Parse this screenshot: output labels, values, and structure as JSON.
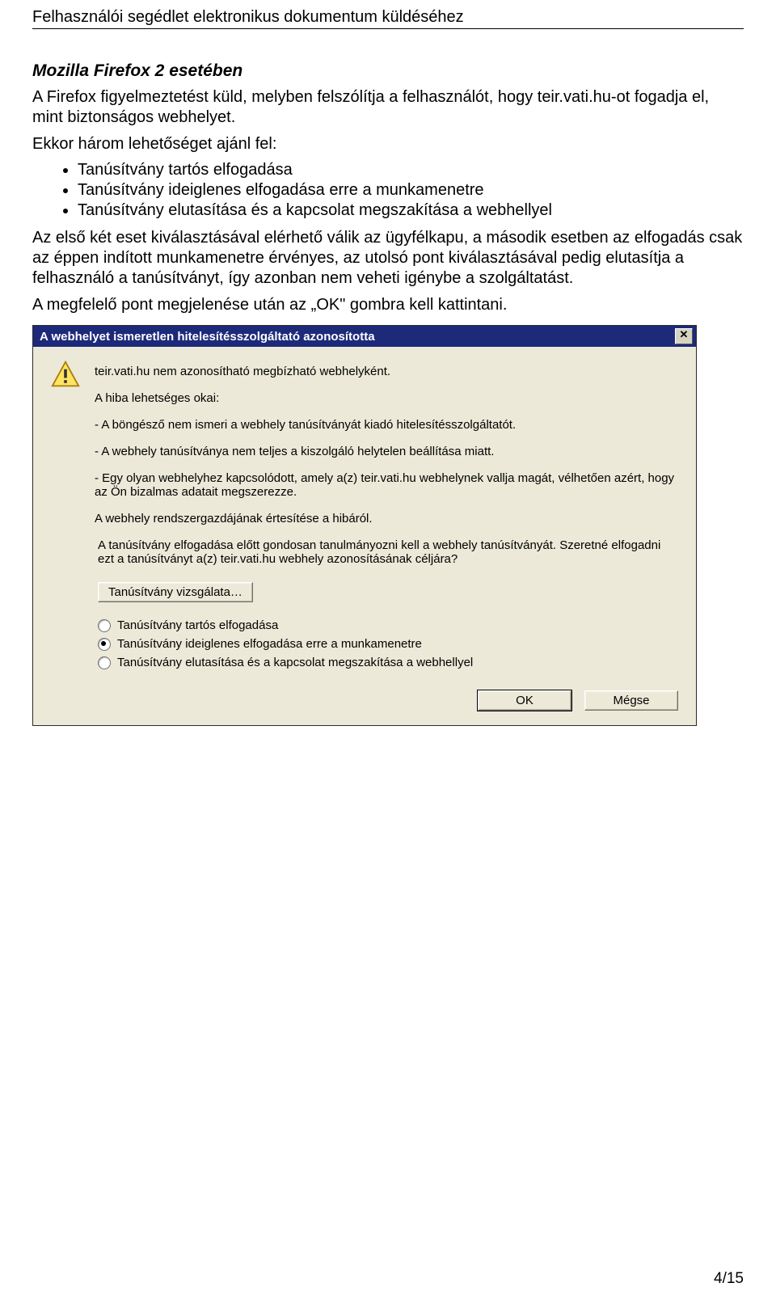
{
  "doc": {
    "header": "Felhasználói segédlet elektronikus dokumentum küldéséhez",
    "section_title": "Mozilla Firefox 2 esetében",
    "intro": "A Firefox figyelmeztetést küld, melyben felszólítja a felhasználót, hogy teir.vati.hu-ot fogadja el, mint biztonságos webhelyet.",
    "list_intro": "Ekkor három lehetőséget ajánl fel:",
    "bullets": [
      "Tanúsítvány tartós elfogadása",
      "Tanúsítvány ideiglenes elfogadása erre a munkamenetre",
      "Tanúsítvány elutasítása és a kapcsolat megszakítása a webhellyel"
    ],
    "para2": "Az első két eset kiválasztásával elérhető válik az ügyfélkapu, a második esetben az elfogadás csak az éppen indított munkamenetre érvényes, az utolsó pont kiválasztásával pedig elutasítja a felhasználó a tanúsítványt, így azonban nem veheti igénybe a szolgáltatást.",
    "para3": "A megfelelő pont megjelenése után az „OK\" gombra kell kattintani.",
    "page_number": "4/15"
  },
  "dialog": {
    "title": "A webhelyet ismeretlen hitelesítésszolgáltató azonosította",
    "line1": "teir.vati.hu nem azonosítható megbízható webhelyként.",
    "reasons_heading": "A hiba lehetséges okai:",
    "reason1": "- A böngésző nem ismeri a webhely tanúsítványát kiadó hitelesítésszolgáltatót.",
    "reason2": "- A webhely tanúsítványa nem teljes a kiszolgáló helytelen beállítása miatt.",
    "reason3": "- Egy olyan webhelyhez kapcsolódott, amely a(z) teir.vati.hu webhelynek vallja magát, vélhetően azért, hogy az Ön bizalmas adatait megszerezze.",
    "admin_notice": "A webhely rendszergazdájának értesítése a hibáról.",
    "accept_prompt": "A tanúsítvány elfogadása előtt gondosan tanulmányozni kell a webhely tanúsítványát. Szeretné elfogadni ezt a tanúsítványt a(z) teir.vati.hu webhely azonosításának céljára?",
    "inspect_button": "Tanúsítvány vizsgálata…",
    "radios": [
      {
        "label": "Tanúsítvány tartós elfogadása",
        "selected": false
      },
      {
        "label": "Tanúsítvány ideiglenes elfogadása erre a munkamenetre",
        "selected": true
      },
      {
        "label": "Tanúsítvány elutasítása és a kapcsolat megszakítása a webhellyel",
        "selected": false
      }
    ],
    "ok": "OK",
    "cancel": "Mégse"
  }
}
